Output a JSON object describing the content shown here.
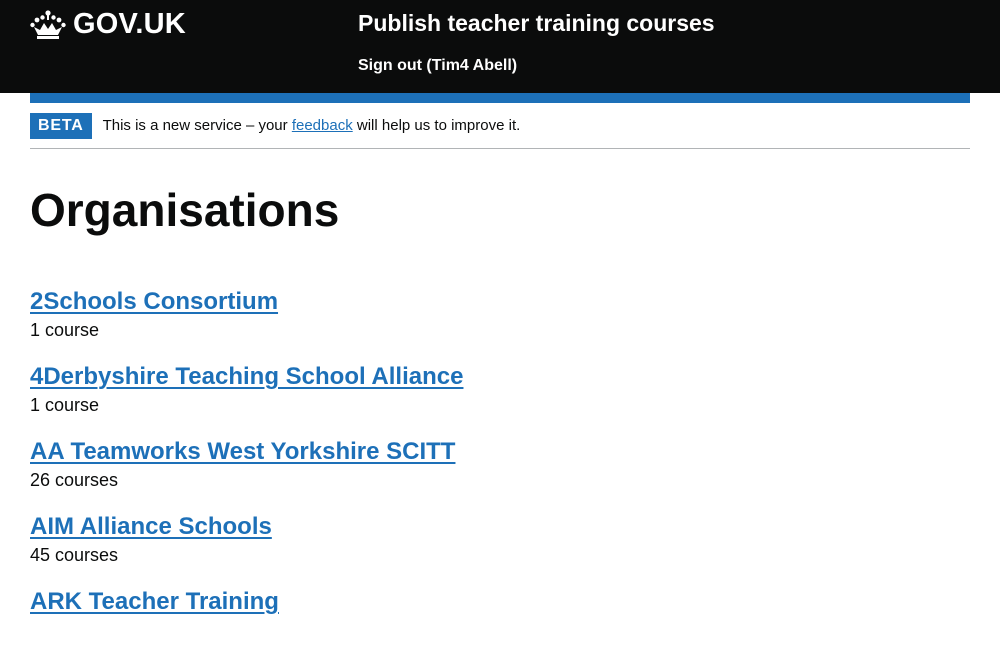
{
  "header": {
    "logo_text": "GOV.UK",
    "service_name": "Publish teacher training courses",
    "sign_out": "Sign out (Tim4 Abell)"
  },
  "phase_banner": {
    "tag": "BETA",
    "text_before": "This is a new service – your ",
    "link": "feedback",
    "text_after": " will help us to improve it."
  },
  "page": {
    "title": "Organisations"
  },
  "organisations": [
    {
      "name": "2Schools Consortium",
      "courses": "1 course"
    },
    {
      "name": "4Derbyshire Teaching School Alliance",
      "courses": "1 course"
    },
    {
      "name": "AA Teamworks West Yorkshire SCITT",
      "courses": "26 courses"
    },
    {
      "name": "AIM Alliance Schools",
      "courses": "45 courses"
    },
    {
      "name": "ARK Teacher Training",
      "courses": ""
    }
  ],
  "colors": {
    "header_bg": "#0b0c0c",
    "brand_blue": "#1d70b8",
    "text": "#0b0c0c",
    "divider": "#b1b4b6"
  },
  "icons": {
    "logo": "crown-icon"
  }
}
